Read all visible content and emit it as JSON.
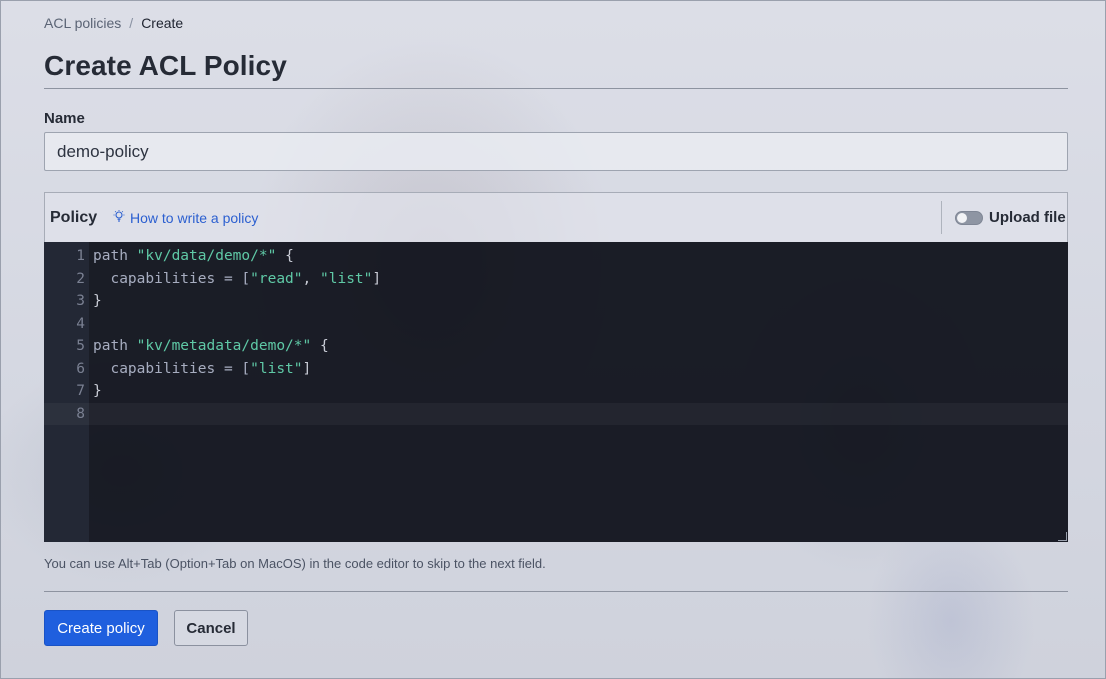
{
  "breadcrumb": {
    "parent": "ACL policies",
    "separator": "/",
    "current": "Create"
  },
  "page": {
    "title": "Create ACL Policy"
  },
  "name_field": {
    "label": "Name",
    "value": "demo-policy"
  },
  "policy": {
    "label": "Policy",
    "help_link": "How to write a policy",
    "help_icon": "lightbulb-icon",
    "upload_label": "Upload file",
    "upload_toggle_on": false
  },
  "editor": {
    "lines": [
      {
        "num": "1",
        "tokens": [
          {
            "t": "path ",
            "k": "kw"
          },
          {
            "t": "\"kv/data/demo/*\"",
            "k": "str"
          },
          {
            "t": " {",
            "k": "punct"
          }
        ]
      },
      {
        "num": "2",
        "tokens": [
          {
            "t": "  capabilities = [",
            "k": "kw"
          },
          {
            "t": "\"read\"",
            "k": "str"
          },
          {
            "t": ", ",
            "k": "punct"
          },
          {
            "t": "\"list\"",
            "k": "str"
          },
          {
            "t": "]",
            "k": "punct"
          }
        ]
      },
      {
        "num": "3",
        "tokens": [
          {
            "t": "}",
            "k": "punct"
          }
        ]
      },
      {
        "num": "4",
        "tokens": []
      },
      {
        "num": "5",
        "tokens": [
          {
            "t": "path ",
            "k": "kw"
          },
          {
            "t": "\"kv/metadata/demo/*\"",
            "k": "str"
          },
          {
            "t": " {",
            "k": "punct"
          }
        ]
      },
      {
        "num": "6",
        "tokens": [
          {
            "t": "  capabilities = [",
            "k": "kw"
          },
          {
            "t": "\"list\"",
            "k": "str"
          },
          {
            "t": "]",
            "k": "punct"
          }
        ]
      },
      {
        "num": "7",
        "tokens": [
          {
            "t": "}",
            "k": "punct"
          }
        ]
      },
      {
        "num": "8",
        "tokens": []
      }
    ],
    "active_line": "8",
    "hint": "You can use Alt+Tab (Option+Tab on MacOS) in the code editor to skip to the next field."
  },
  "actions": {
    "create_label": "Create policy",
    "cancel_label": "Cancel"
  },
  "colors": {
    "primary": "#1f5fde",
    "link": "#2b5fd0",
    "editor_bg": "#0c0e18",
    "string_token": "#5fc9a6"
  }
}
